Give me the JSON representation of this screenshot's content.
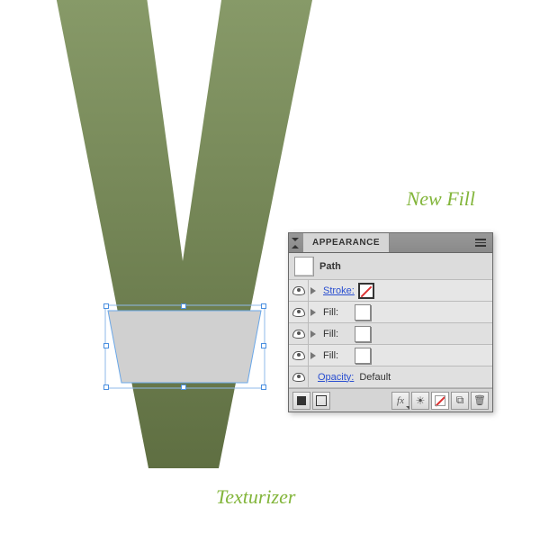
{
  "annotations": {
    "new_fill": "New Fill",
    "texturizer": "Texturizer"
  },
  "panel": {
    "title": "APPEARANCE",
    "target": "Path",
    "rows": {
      "stroke": {
        "label": "Stroke:",
        "swatch": "none"
      },
      "fill1": {
        "label": "Fill:",
        "swatch": "hollow"
      },
      "fill2": {
        "label": "Fill:",
        "swatch": "white"
      },
      "fill3": {
        "label": "Fill:",
        "swatch": "white"
      },
      "opacity": {
        "label": "Opacity:",
        "value": "Default"
      }
    },
    "footer_icons": {
      "solid": "add-new-fill-icon",
      "hollow": "add-new-stroke-icon",
      "fx": "add-effect-icon",
      "sun": "clear-appearance-icon",
      "nofill": "no-fill-icon",
      "dup": "duplicate-icon",
      "trash": "delete-icon"
    }
  }
}
